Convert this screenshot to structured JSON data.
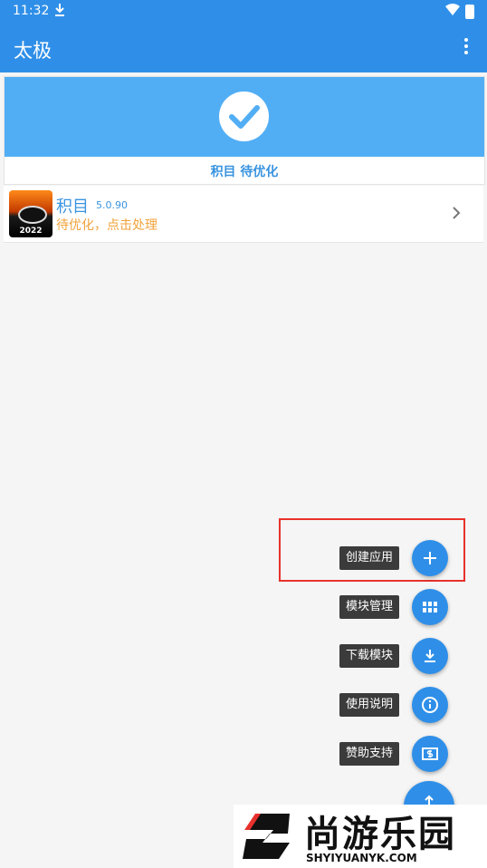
{
  "status_bar": {
    "time": "11:32",
    "download_icon": "download-icon",
    "wifi_icon": "wifi-icon",
    "battery_icon": "battery-icon"
  },
  "app_bar": {
    "title": "太极",
    "overflow_icon": "more-vert-icon"
  },
  "status_card": {
    "check_icon": "check-circle-icon",
    "status_text": "积目 待优化",
    "banner_color": "#52aef4"
  },
  "app_item": {
    "name": "积目",
    "version": "5.0.90",
    "subtitle": "待优化，点击处理",
    "icon_year": "2022",
    "chevron_icon": "chevron-right-icon"
  },
  "fab_menu": {
    "items": [
      {
        "label": "创建应用",
        "icon": "plus-icon"
      },
      {
        "label": "模块管理",
        "icon": "grid-icon"
      },
      {
        "label": "下载模块",
        "icon": "download-icon"
      },
      {
        "label": "使用说明",
        "icon": "info-icon"
      },
      {
        "label": "赞助支持",
        "icon": "money-icon"
      }
    ],
    "main_icon": "arrow-up-icon",
    "accent_color": "#2f8fe8"
  },
  "watermark": {
    "brand": "尚游乐园",
    "url": "SHYIYUANYK.COM"
  }
}
